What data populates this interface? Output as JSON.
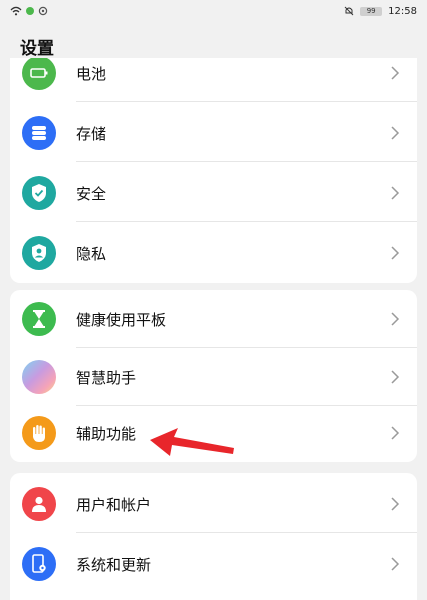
{
  "status_bar": {
    "time": "12:58",
    "battery": "99"
  },
  "page_title": "设置",
  "groups": [
    {
      "items": [
        {
          "label": "电池",
          "icon": "battery-icon",
          "color": "#4cb84c"
        },
        {
          "label": "存储",
          "icon": "storage-icon",
          "color": "#2d6ef6"
        },
        {
          "label": "安全",
          "icon": "shield-check-icon",
          "color": "#1fa8a0"
        },
        {
          "label": "隐私",
          "icon": "privacy-shield-icon",
          "color": "#1fa8a0"
        }
      ]
    },
    {
      "items": [
        {
          "label": "健康使用平板",
          "icon": "hourglass-icon",
          "color": "#3dbb4f"
        },
        {
          "label": "智慧助手",
          "icon": "smart-assistant-icon",
          "color": "#b58ad8"
        },
        {
          "label": "辅助功能",
          "icon": "hand-icon",
          "color": "#f49a1a"
        }
      ]
    },
    {
      "items": [
        {
          "label": "用户和帐户",
          "icon": "user-icon",
          "color": "#f0454a"
        },
        {
          "label": "系统和更新",
          "icon": "phone-settings-icon",
          "color": "#2d6ef6"
        }
      ]
    }
  ],
  "annotation_color": "#e8262b"
}
